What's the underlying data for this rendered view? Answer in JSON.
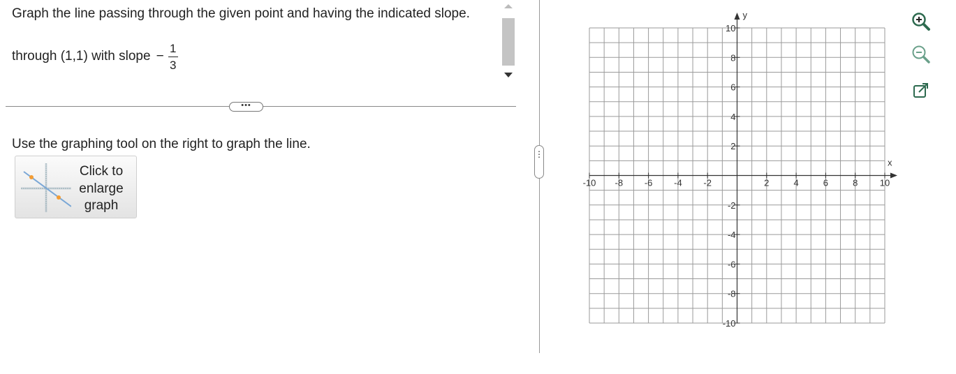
{
  "question": {
    "title": "Graph the line passing through the given point and having the indicated slope.",
    "through_text": "through (1,1) with slope",
    "slope_sign": "−",
    "slope_numerator": "1",
    "slope_denominator": "3"
  },
  "more_button_label": "•••",
  "instruction": "Use the graphing tool on the right to graph the line.",
  "enlarge_button": {
    "line1": "Click to",
    "line2": "enlarge",
    "line3": "graph"
  },
  "pane_handle_label": "⋮",
  "graph": {
    "x_axis_label": "x",
    "y_axis_label": "y",
    "x_range": [
      -10,
      10
    ],
    "y_range": [
      -10,
      10
    ],
    "grid_step": 1,
    "x_tick_labels": [
      "-10",
      "-8",
      "-6",
      "-4",
      "-2",
      "2",
      "4",
      "6",
      "8",
      "10"
    ],
    "y_tick_labels": [
      "10",
      "8",
      "6",
      "4",
      "2",
      "-2",
      "-4",
      "-6",
      "-8",
      "-10"
    ]
  },
  "tools": [
    "zoom-in-icon",
    "zoom-out-icon",
    "popout-icon"
  ],
  "colors": {
    "tool_icon": "#2d6a4f",
    "point_orange": "#f39c34",
    "grid": "#999999"
  }
}
